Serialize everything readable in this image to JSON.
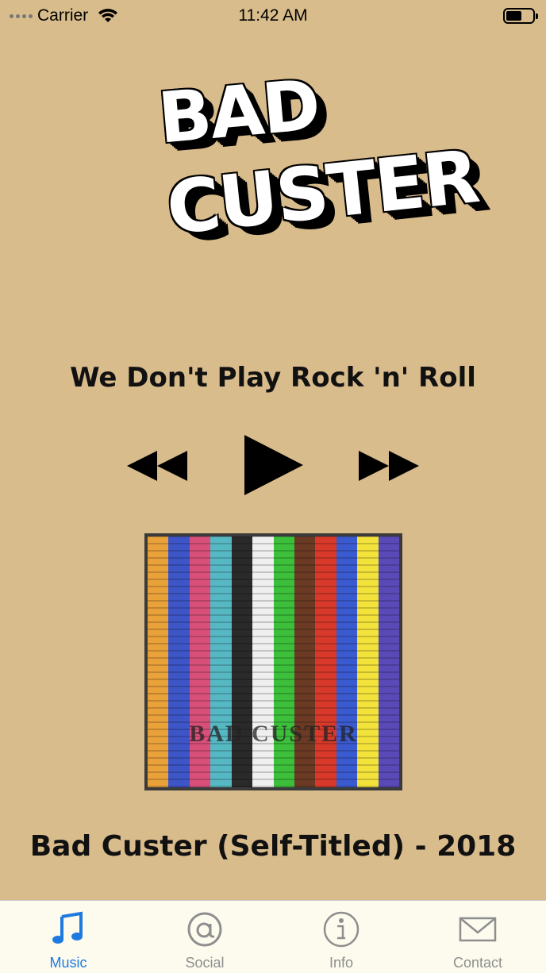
{
  "status_bar": {
    "carrier": "Carrier",
    "time": "11:42 AM"
  },
  "logo": {
    "line1": "BAD",
    "line2": "CUSTER"
  },
  "player": {
    "song_title": "We Don't Play Rock 'n' Roll",
    "rewind_icon": "rewind-icon",
    "play_icon": "play-icon",
    "fast_forward_icon": "fast-forward-icon"
  },
  "album": {
    "art_text": "BAD CUSTER",
    "caption": "Bad Custer (Self-Titled) - 2018",
    "stripe_colors": [
      "#e9a13a",
      "#3e55c8",
      "#d8507a",
      "#56b8c2",
      "#2a2a2a",
      "#efefef",
      "#3cbf3a",
      "#6b3a24",
      "#d8392a",
      "#3a5ad0",
      "#f2e23a",
      "#5a4ab8"
    ]
  },
  "tab_bar": {
    "active_color": "#1f7ae0",
    "inactive_color": "#8e8e8e",
    "tabs": [
      {
        "label": "Music",
        "icon": "music-note-icon"
      },
      {
        "label": "Social",
        "icon": "at-sign-icon"
      },
      {
        "label": "Info",
        "icon": "info-icon"
      },
      {
        "label": "Contact",
        "icon": "envelope-icon"
      }
    ]
  }
}
